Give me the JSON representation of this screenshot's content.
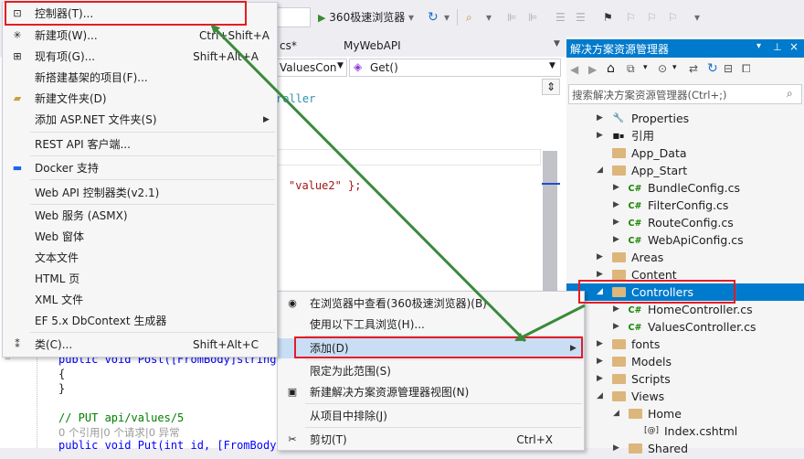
{
  "toolbar": {
    "run_label": "360极速浏览器",
    "combo_arrow": "▾"
  },
  "editor": {
    "tab_fragment": "cs*",
    "tab_project": "MyWebAPI",
    "nav_class": "ValuesCon",
    "nav_member": "Get()",
    "code_fragment_1": "roller",
    "code_fragment_2": "\"value2\" };",
    "code_post": "public void Post([FromBody]string",
    "code_brace_open": "{",
    "code_brace_close": "}",
    "code_comment": "// PUT api/values/5",
    "code_codelens": "0 个引用|0 个请求|0 异常",
    "code_put": "public void Put(int id, [FromBody]"
  },
  "solution_explorer": {
    "title": "解决方案资源管理器",
    "search_placeholder": "搜索解决方案资源管理器(Ctrl+;)",
    "items": [
      {
        "label": "Properties",
        "icon": "wrench-icon"
      },
      {
        "label": "引用",
        "icon": "references-icon"
      },
      {
        "label": "App_Data",
        "icon": "folder-icon"
      },
      {
        "label": "App_Start",
        "icon": "folder-icon"
      },
      {
        "label": "BundleConfig.cs",
        "icon": "csharp-file-icon"
      },
      {
        "label": "FilterConfig.cs",
        "icon": "csharp-file-icon"
      },
      {
        "label": "RouteConfig.cs",
        "icon": "csharp-file-icon"
      },
      {
        "label": "WebApiConfig.cs",
        "icon": "csharp-file-icon"
      },
      {
        "label": "Areas",
        "icon": "folder-icon"
      },
      {
        "label": "Content",
        "icon": "folder-icon"
      },
      {
        "label": "Controllers",
        "icon": "folder-icon"
      },
      {
        "label": "HomeController.cs",
        "icon": "csharp-file-icon"
      },
      {
        "label": "ValuesController.cs",
        "icon": "csharp-file-icon"
      },
      {
        "label": "fonts",
        "icon": "folder-icon"
      },
      {
        "label": "Models",
        "icon": "folder-icon"
      },
      {
        "label": "Scripts",
        "icon": "folder-icon"
      },
      {
        "label": "Views",
        "icon": "folder-icon"
      },
      {
        "label": "Home",
        "icon": "folder-icon"
      },
      {
        "label": "Index.cshtml",
        "icon": "razor-file-icon"
      },
      {
        "label": "Shared",
        "icon": "folder-icon"
      }
    ]
  },
  "context_menu": {
    "items": [
      {
        "label": "在浏览器中查看(360极速浏览器)(B)",
        "shortcut": ""
      },
      {
        "label": "使用以下工具浏览(H)...",
        "shortcut": ""
      },
      {
        "label": "添加(D)",
        "shortcut": ""
      },
      {
        "label": "限定为此范围(S)",
        "shortcut": ""
      },
      {
        "label": "新建解决方案资源管理器视图(N)",
        "shortcut": ""
      },
      {
        "label": "从项目中排除(J)",
        "shortcut": ""
      },
      {
        "label": "剪切(T)",
        "shortcut": "Ctrl+X"
      }
    ]
  },
  "add_submenu": {
    "items": [
      {
        "label": "控制器(T)...",
        "shortcut": ""
      },
      {
        "label": "新建项(W)...",
        "shortcut": "Ctrl+Shift+A"
      },
      {
        "label": "现有项(G)...",
        "shortcut": "Shift+Alt+A"
      },
      {
        "label": "新搭建基架的项目(F)...",
        "shortcut": ""
      },
      {
        "label": "新建文件夹(D)",
        "shortcut": ""
      },
      {
        "label": "添加 ASP.NET 文件夹(S)",
        "shortcut": ""
      },
      {
        "label": "REST API 客户端...",
        "shortcut": ""
      },
      {
        "label": "Docker 支持",
        "shortcut": ""
      },
      {
        "label": "Web API 控制器类(v2.1)",
        "shortcut": ""
      },
      {
        "label": "Web 服务 (ASMX)",
        "shortcut": ""
      },
      {
        "label": "Web 窗体",
        "shortcut": ""
      },
      {
        "label": "文本文件",
        "shortcut": ""
      },
      {
        "label": "HTML 页",
        "shortcut": ""
      },
      {
        "label": "XML 文件",
        "shortcut": ""
      },
      {
        "label": "EF 5.x DbContext 生成器",
        "shortcut": ""
      },
      {
        "label": "类(C)...",
        "shortcut": "Shift+Alt+C"
      }
    ]
  },
  "colors": {
    "accent": "#007acc",
    "highlight_box": "#e51c23",
    "arrow": "#3a8a3a"
  }
}
